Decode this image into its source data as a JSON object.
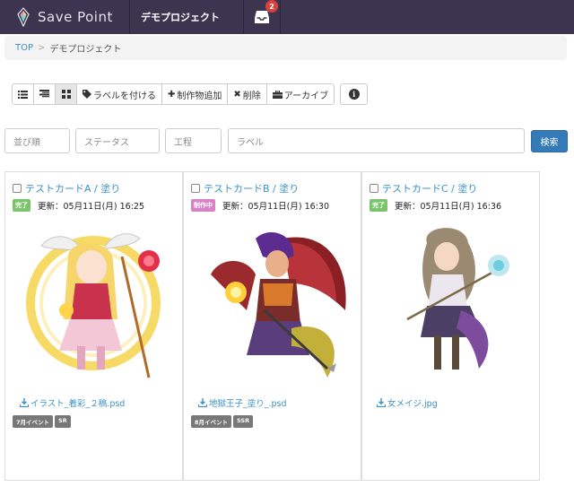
{
  "app": {
    "name": "Save Point",
    "project_tab": "デモプロジェクト",
    "inbox_count": "2"
  },
  "breadcrumb": {
    "root": "TOP",
    "separator": ">",
    "current": "デモプロジェクト"
  },
  "toolbar": {
    "view_list_icon": "list-icon",
    "view_detail_icon": "detail-list-icon",
    "view_grid_icon": "grid-icon",
    "label_button": "ラベルを付ける",
    "add_button": "制作物追加",
    "delete_button": "削除",
    "archive_button": "アーカイブ",
    "info_icon": "info-icon"
  },
  "filters": {
    "sort_placeholder": "並び順",
    "status_placeholder": "ステータス",
    "process_placeholder": "工程",
    "label_placeholder": "ラベル",
    "search_button": "検索"
  },
  "cards": [
    {
      "title": "テストカードA / 塗り",
      "status": "完了",
      "updated": "更新：05月11日(月) 16:25",
      "file": "イラスト_着彩_２稿.psd",
      "tags": [
        "7月イベント",
        "SR"
      ]
    },
    {
      "title": "テストカードB / 塗り",
      "status": "制作中",
      "updated": "更新：05月11日(月) 16:30",
      "file": "地獄王子_塗り_.psd",
      "tags": [
        "8月イベント",
        "SSR"
      ]
    },
    {
      "title": "テストカードC / 塗り",
      "status": "完了",
      "updated": "更新：05月11日(月) 16:36",
      "file": "女メイジ.jpg",
      "tags": []
    }
  ],
  "colors": {
    "navbar": "#3d3450",
    "link": "#3a93c6",
    "status_done": "#7cc46b",
    "status_wip": "#d980c7",
    "search_button": "#337ab7",
    "badge": "#d9413b"
  }
}
